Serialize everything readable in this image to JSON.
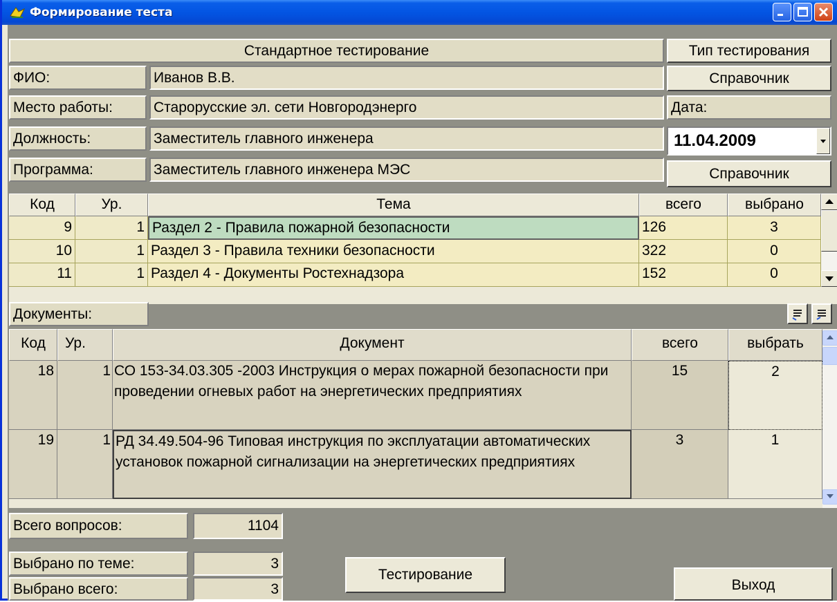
{
  "window": {
    "title": "Формирование теста"
  },
  "header": {
    "mode_label": "Стандартное тестирование",
    "mode_button": "Тип тестирования",
    "fio_label": "ФИО:",
    "fio_value": "Иванов В.В.",
    "directory_button_1": "Справочник",
    "work_label": "Место работы:",
    "work_value": "Старорусские эл. сети Новгородэнерго",
    "date_label": "Дата:",
    "position_label": "Должность:",
    "position_value": "Заместитель главного инженера",
    "date_value": "11.04.2009",
    "program_label": "Программа:",
    "program_value": "Заместитель главного инженера  МЭС",
    "directory_button_2": "Справочник"
  },
  "topics": {
    "columns": [
      "Код",
      "Ур.",
      "Тема",
      "всего",
      "выбрано"
    ],
    "rows": [
      {
        "code": "9",
        "level": "1",
        "topic": "Раздел 2 - Правила пожарной безопасности",
        "total": "126",
        "selected": "3"
      },
      {
        "code": "10",
        "level": "1",
        "topic": "Раздел 3 - Правила техники безопасности",
        "total": "322",
        "selected": "0"
      },
      {
        "code": "11",
        "level": "1",
        "topic": "Раздел 4 - Документы Ростехнадзора",
        "total": "152",
        "selected": "0"
      }
    ]
  },
  "documents": {
    "label": "Документы:",
    "columns": [
      "Код",
      "Ур.",
      "Документ",
      "всего",
      "выбрать"
    ],
    "rows": [
      {
        "code": "18",
        "level": "1",
        "doc": "СО 153-34.03.305 -2003 Инструкция о мерах пожарной безопасности при проведении огневых работ на энергетических предприятиях",
        "total": "15",
        "select": "2"
      },
      {
        "code": "19",
        "level": "1",
        "doc": "РД 34.49.504-96 Типовая инструкция по эксплуатации автоматических установок пожарной сигнализации на энергетических предприятиях",
        "total": "3",
        "select": "1"
      }
    ]
  },
  "footer": {
    "total_questions_label": "Всего вопросов:",
    "total_questions_value": "1104",
    "selected_topic_label": "Выбрано по теме:",
    "selected_topic_value": "3",
    "selected_total_label": "Выбрано всего:",
    "selected_total_value": "3",
    "testing_button": "Тестирование",
    "exit_button": "Выход"
  },
  "icons": [
    "app-icon",
    "minimize-icon",
    "maximize-icon",
    "close-icon",
    "dropdown-arrow-icon",
    "scroll-up-icon",
    "scroll-down-icon",
    "expand-icon",
    "collapse-icon"
  ]
}
